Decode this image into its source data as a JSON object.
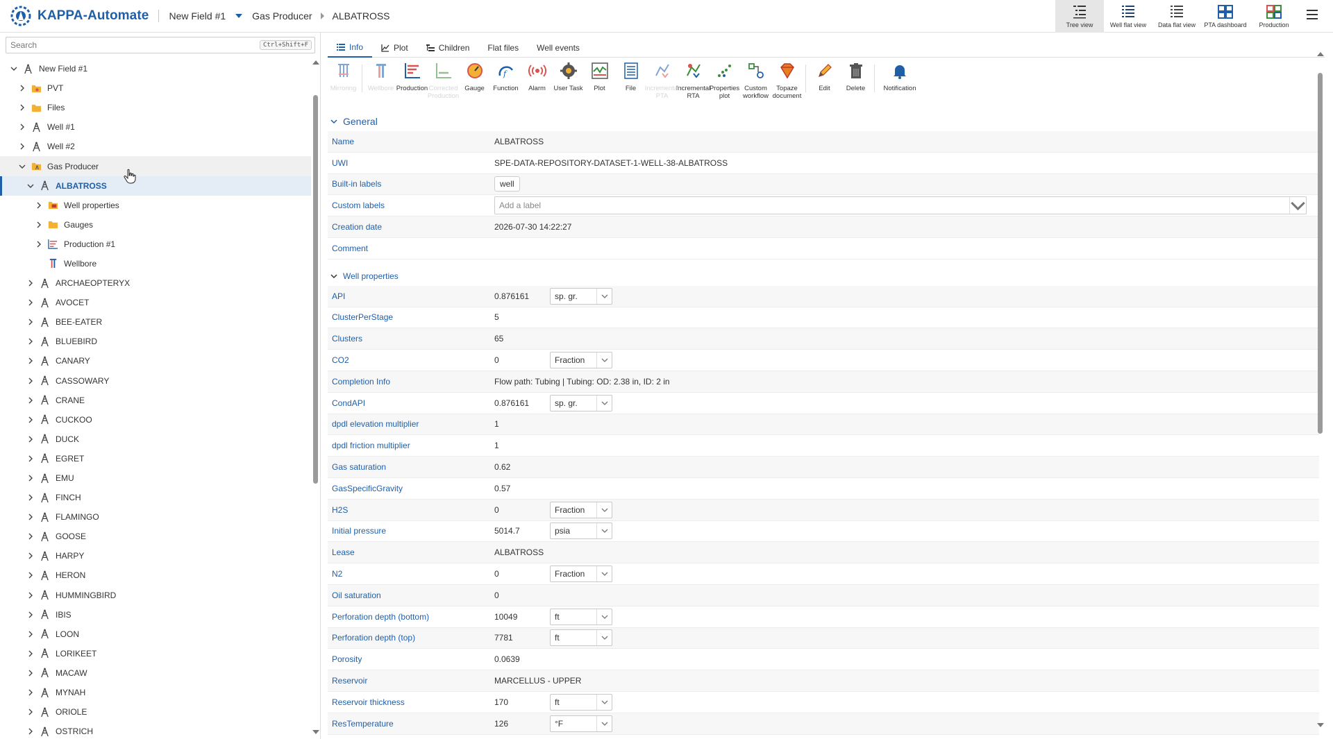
{
  "app": {
    "title": "KAPPA-Automate",
    "brand_color": "#1f5fa8"
  },
  "breadcrumb": {
    "field": "New Field #1",
    "group": "Gas Producer",
    "well": "ALBATROSS"
  },
  "view_buttons": [
    {
      "label": "Tree view",
      "icon": "tree-view-icon",
      "active": true
    },
    {
      "label": "Well flat view",
      "icon": "well-flat-view-icon",
      "active": false
    },
    {
      "label": "Data flat view",
      "icon": "data-flat-view-icon",
      "active": false
    },
    {
      "label": "PTA dashboard",
      "icon": "pta-dashboard-icon",
      "active": false
    },
    {
      "label": "Production",
      "icon": "production-dashboard-icon",
      "active": false
    }
  ],
  "search": {
    "placeholder": "Search",
    "shortcut": "Ctrl+Shift+F"
  },
  "tree": [
    {
      "label": "New Field #1",
      "depth": 0,
      "chevron": "down",
      "icon": "field-icon"
    },
    {
      "label": "PVT",
      "depth": 1,
      "chevron": "right",
      "icon": "pvt-folder-icon"
    },
    {
      "label": "Files",
      "depth": 1,
      "chevron": "right",
      "icon": "files-folder-icon"
    },
    {
      "label": "Well #1",
      "depth": 1,
      "chevron": "right",
      "icon": "well-icon"
    },
    {
      "label": "Well #2",
      "depth": 1,
      "chevron": "right",
      "icon": "well-icon"
    },
    {
      "label": "Gas Producer",
      "depth": 1,
      "chevron": "down",
      "icon": "group-folder-icon",
      "hover": true
    },
    {
      "label": "ALBATROSS",
      "depth": 2,
      "chevron": "down",
      "icon": "well-icon",
      "selected": true
    },
    {
      "label": "Well properties",
      "depth": 3,
      "chevron": "right",
      "icon": "well-properties-icon"
    },
    {
      "label": "Gauges",
      "depth": 3,
      "chevron": "right",
      "icon": "gauges-folder-icon"
    },
    {
      "label": "Production #1",
      "depth": 3,
      "chevron": "right",
      "icon": "production-icon"
    },
    {
      "label": "Wellbore",
      "depth": 3,
      "chevron": "none",
      "icon": "wellbore-icon"
    },
    {
      "label": "ARCHAEOPTERYX",
      "depth": 2,
      "chevron": "right",
      "icon": "well-icon"
    },
    {
      "label": "AVOCET",
      "depth": 2,
      "chevron": "right",
      "icon": "well-icon"
    },
    {
      "label": "BEE-EATER",
      "depth": 2,
      "chevron": "right",
      "icon": "well-icon"
    },
    {
      "label": "BLUEBIRD",
      "depth": 2,
      "chevron": "right",
      "icon": "well-icon"
    },
    {
      "label": "CANARY",
      "depth": 2,
      "chevron": "right",
      "icon": "well-icon"
    },
    {
      "label": "CASSOWARY",
      "depth": 2,
      "chevron": "right",
      "icon": "well-icon"
    },
    {
      "label": "CRANE",
      "depth": 2,
      "chevron": "right",
      "icon": "well-icon"
    },
    {
      "label": "CUCKOO",
      "depth": 2,
      "chevron": "right",
      "icon": "well-icon"
    },
    {
      "label": "DUCK",
      "depth": 2,
      "chevron": "right",
      "icon": "well-icon"
    },
    {
      "label": "EGRET",
      "depth": 2,
      "chevron": "right",
      "icon": "well-icon"
    },
    {
      "label": "EMU",
      "depth": 2,
      "chevron": "right",
      "icon": "well-icon"
    },
    {
      "label": "FINCH",
      "depth": 2,
      "chevron": "right",
      "icon": "well-icon"
    },
    {
      "label": "FLAMINGO",
      "depth": 2,
      "chevron": "right",
      "icon": "well-icon"
    },
    {
      "label": "GOOSE",
      "depth": 2,
      "chevron": "right",
      "icon": "well-icon"
    },
    {
      "label": "HARPY",
      "depth": 2,
      "chevron": "right",
      "icon": "well-icon"
    },
    {
      "label": "HERON",
      "depth": 2,
      "chevron": "right",
      "icon": "well-icon"
    },
    {
      "label": "HUMMINGBIRD",
      "depth": 2,
      "chevron": "right",
      "icon": "well-icon"
    },
    {
      "label": "IBIS",
      "depth": 2,
      "chevron": "right",
      "icon": "well-icon"
    },
    {
      "label": "LOON",
      "depth": 2,
      "chevron": "right",
      "icon": "well-icon"
    },
    {
      "label": "LORIKEET",
      "depth": 2,
      "chevron": "right",
      "icon": "well-icon"
    },
    {
      "label": "MACAW",
      "depth": 2,
      "chevron": "right",
      "icon": "well-icon"
    },
    {
      "label": "MYNAH",
      "depth": 2,
      "chevron": "right",
      "icon": "well-icon"
    },
    {
      "label": "ORIOLE",
      "depth": 2,
      "chevron": "right",
      "icon": "well-icon"
    },
    {
      "label": "OSTRICH",
      "depth": 2,
      "chevron": "right",
      "icon": "well-icon"
    }
  ],
  "tabs": [
    {
      "label": "Info",
      "icon": "info-list-icon",
      "active": true
    },
    {
      "label": "Plot",
      "icon": "plot-icon",
      "active": false
    },
    {
      "label": "Children",
      "icon": "children-icon",
      "active": false
    },
    {
      "label": "Flat files",
      "icon": "",
      "active": false
    },
    {
      "label": "Well events",
      "icon": "",
      "active": false
    }
  ],
  "toolbar": [
    {
      "label": "Mirroring",
      "icon": "mirroring-icon",
      "disabled": true
    },
    {
      "sep": true
    },
    {
      "label": "Wellbore",
      "icon": "wellbore-icon",
      "disabled": true
    },
    {
      "label": "Production",
      "icon": "production-icon",
      "disabled": false
    },
    {
      "label": "Corrected Production",
      "icon": "corrected-production-icon",
      "disabled": true
    },
    {
      "label": "Gauge",
      "icon": "gauge-icon",
      "disabled": false
    },
    {
      "label": "Function",
      "icon": "function-icon",
      "disabled": false
    },
    {
      "label": "Alarm",
      "icon": "alarm-icon",
      "disabled": false
    },
    {
      "label": "User Task",
      "icon": "user-task-icon",
      "disabled": false
    },
    {
      "label": "Plot",
      "icon": "plot-icon",
      "disabled": false
    },
    {
      "label": "File",
      "icon": "file-icon",
      "disabled": false
    },
    {
      "label": "Incremental PTA",
      "icon": "incremental-pta-icon",
      "disabled": true
    },
    {
      "label": "Incremental RTA",
      "icon": "incremental-rta-icon",
      "disabled": false
    },
    {
      "label": "Properties plot",
      "icon": "properties-plot-icon",
      "disabled": false
    },
    {
      "label": "Custom workflow",
      "icon": "custom-workflow-icon",
      "disabled": false
    },
    {
      "label": "Topaze document",
      "icon": "topaze-document-icon",
      "disabled": false
    },
    {
      "sep": true
    },
    {
      "label": "Edit",
      "icon": "edit-pencil-icon",
      "disabled": false
    },
    {
      "label": "Delete",
      "icon": "trash-icon",
      "disabled": false
    },
    {
      "sep": true
    },
    {
      "label": "Notification",
      "icon": "bell-icon",
      "disabled": false,
      "wide": true
    }
  ],
  "general": {
    "title": "General",
    "rows": [
      {
        "key": "Name",
        "value": "ALBATROSS"
      },
      {
        "key": "UWI",
        "value": "SPE-DATA-REPOSITORY-DATASET-1-WELL-38-ALBATROSS"
      },
      {
        "key": "Built-in labels",
        "chip": "well"
      },
      {
        "key": "Custom labels",
        "placeholder": "Add a label"
      },
      {
        "key": "Creation date",
        "value": "2026-07-30 14:22:27"
      },
      {
        "key": "Comment",
        "value": ""
      }
    ]
  },
  "well_properties": {
    "title": "Well properties",
    "rows": [
      {
        "key": "API",
        "value": "0.876161",
        "unit": "sp. gr."
      },
      {
        "key": "ClusterPerStage",
        "value": "5"
      },
      {
        "key": "Clusters",
        "value": "65"
      },
      {
        "key": "CO2",
        "value": "0",
        "unit": "Fraction"
      },
      {
        "key": "Completion Info",
        "value": "Flow path: Tubing | Tubing: OD: 2.38 in, ID: 2 in"
      },
      {
        "key": "CondAPI",
        "value": "0.876161",
        "unit": "sp. gr."
      },
      {
        "key": "dpdl elevation multiplier",
        "value": "1"
      },
      {
        "key": "dpdl friction multiplier",
        "value": "1"
      },
      {
        "key": "Gas saturation",
        "value": "0.62"
      },
      {
        "key": "GasSpecificGravity",
        "value": "0.57"
      },
      {
        "key": "H2S",
        "value": "0",
        "unit": "Fraction"
      },
      {
        "key": "Initial pressure",
        "value": "5014.7",
        "unit": "psia"
      },
      {
        "key": "Lease",
        "value": "ALBATROSS"
      },
      {
        "key": "N2",
        "value": "0",
        "unit": "Fraction"
      },
      {
        "key": "Oil saturation",
        "value": "0"
      },
      {
        "key": "Perforation depth (bottom)",
        "value": "10049",
        "unit": "ft"
      },
      {
        "key": "Perforation depth (top)",
        "value": "7781",
        "unit": "ft"
      },
      {
        "key": "Porosity",
        "value": "0.0639"
      },
      {
        "key": "Reservoir",
        "value": "MARCELLUS - UPPER"
      },
      {
        "key": "Reservoir thickness",
        "value": "170",
        "unit": "ft"
      },
      {
        "key": "ResTemperature",
        "value": "126",
        "unit": "°F"
      }
    ]
  }
}
